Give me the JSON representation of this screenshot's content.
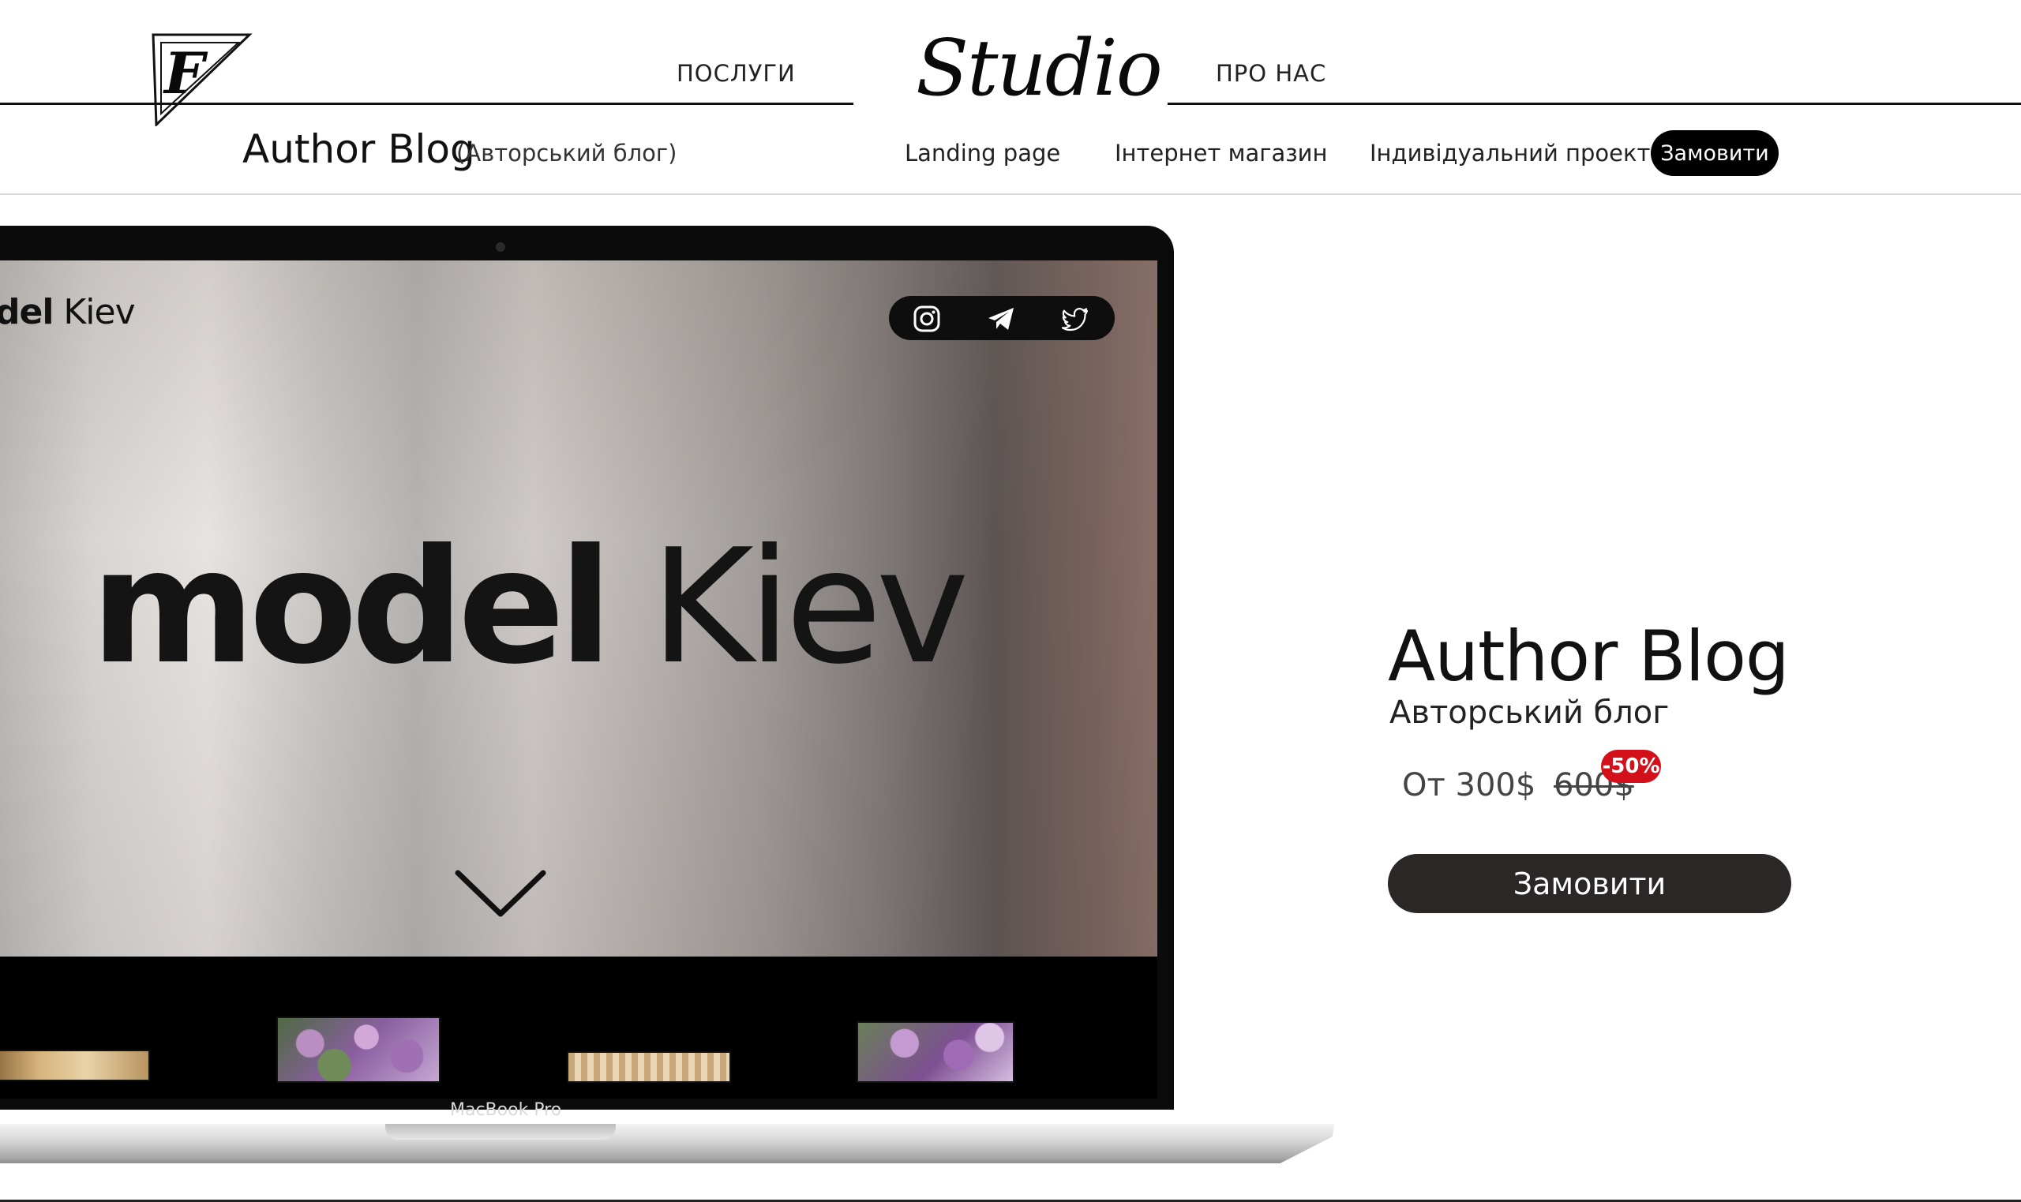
{
  "header": {
    "logo_icon": "f-monogram-triangle-logo",
    "nav_left": "ПОСЛУГИ",
    "brand": "Studio",
    "nav_right": "ПРО НАС"
  },
  "breadcrumb": {
    "title": "Author Blog",
    "subtitle": "(Авторський блог)"
  },
  "subnav": {
    "items": [
      "Landing page",
      "Інтернет магазин",
      "Індивідуальний проект"
    ],
    "order_button": "Замовити"
  },
  "mockup": {
    "brand_bold": "del",
    "brand_light": "Kiev",
    "hero_bold": "model",
    "hero_light": "Kiev",
    "social_icons": [
      "instagram-icon",
      "telegram-icon",
      "twitter-icon"
    ],
    "scroll_icon": "chevron-down-icon",
    "device_label": "MacBook Pro"
  },
  "product": {
    "title": "Author Blog",
    "subtitle": "Авторський блог",
    "price": "От 300$",
    "old_price": "600$",
    "discount": "-50%",
    "order_button": "Замовити"
  },
  "colors": {
    "accent": "#000000",
    "discount": "#d3101a",
    "button_dark": "#2b2727"
  }
}
